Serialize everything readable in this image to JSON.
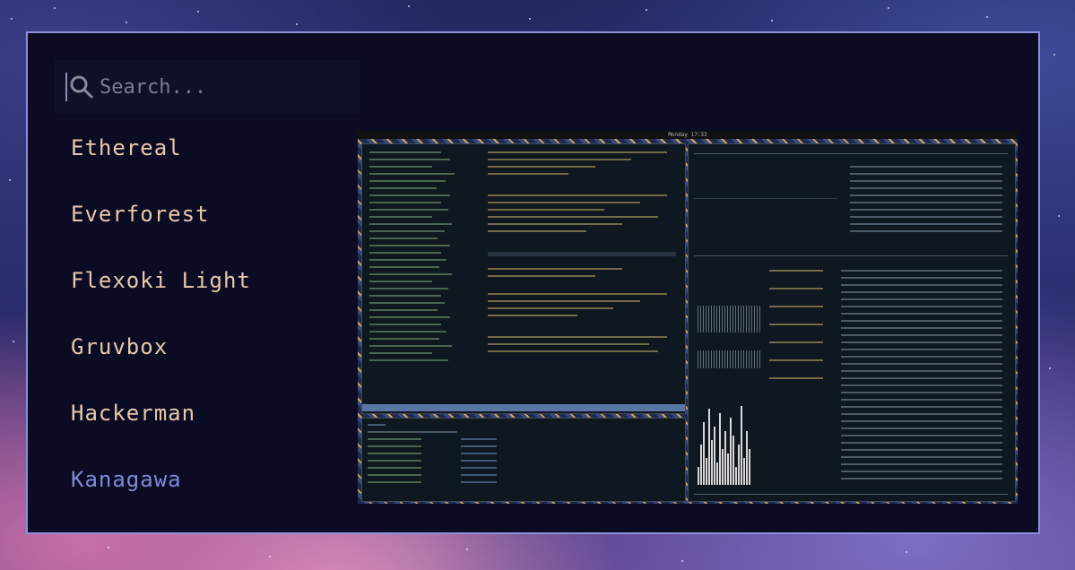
{
  "search": {
    "placeholder": "Search..."
  },
  "themes": [
    {
      "label": "Ethereal",
      "selected": false
    },
    {
      "label": "Everforest",
      "selected": false
    },
    {
      "label": "Flexoki Light",
      "selected": false
    },
    {
      "label": "Gruvbox",
      "selected": false
    },
    {
      "label": "Hackerman",
      "selected": false
    },
    {
      "label": "Kanagawa",
      "selected": true
    }
  ],
  "preview": {
    "clock": "Monday 17:33"
  },
  "colors": {
    "accent": "#7e8ad8",
    "item_text": "#e8c8aa",
    "border": "#8b8fd6",
    "panel_bg": "#0b0c24"
  }
}
